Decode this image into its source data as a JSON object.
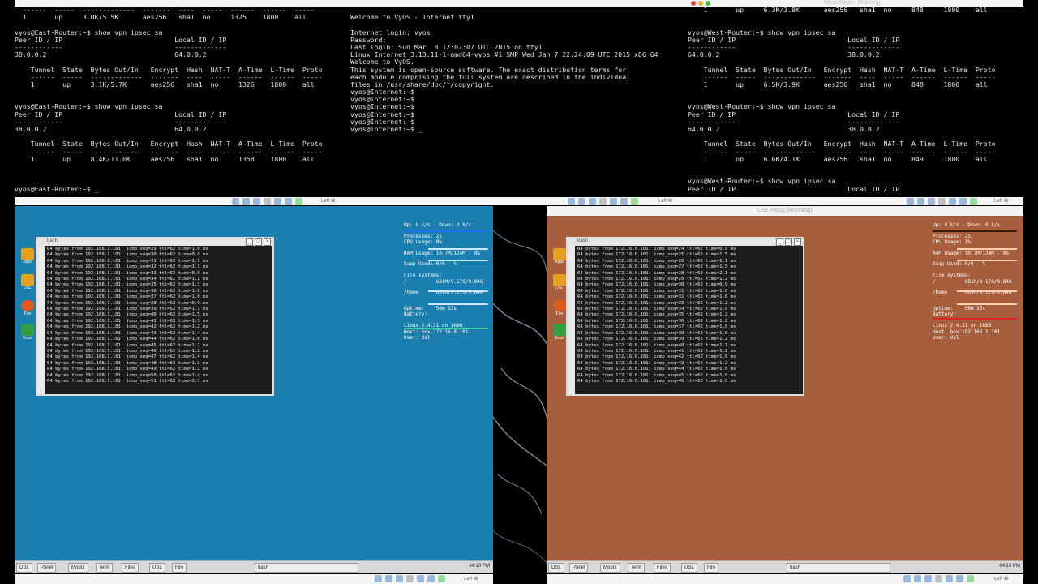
{
  "east_router_terminal": {
    "lines": [
      "  ------  -----  -------------  -------  ----  -----  ------  ------  -----",
      "  1       up     3.0K/5.5K      aes256   sha1  no     1325    1800    all",
      "",
      "vyos@East-Router:~$ show vpn ipsec sa",
      "Peer ID / IP                            Local ID / IP",
      "------------                            -------------",
      "38.0.0.2                                64.0.0.2",
      "",
      "    Tunnel  State  Bytes Out/In   Encrypt  Hash  NAT-T  A-Time  L-Time  Proto",
      "    ------  -----  -------------  -------  ----  -----  ------  ------  -----",
      "    1       up     3.1K/5.7K      aes256   sha1  no     1326    1800    all",
      "",
      "",
      "vyos@East-Router:~$ show vpn ipsec sa",
      "Peer ID / IP                            Local ID / IP",
      "------------                            -------------",
      "38.0.0.2                                64.0.0.2",
      "",
      "    Tunnel  State  Bytes Out/In   Encrypt  Hash  NAT-T  A-Time  L-Time  Proto",
      "    ------  -----  -------------  -------  ----  -----  ------  ------  -----",
      "    1       up     8.4K/11.0K     aes256   sha1  no     1358    1800    all",
      "",
      "",
      "",
      "vyos@East-Router:~$ _"
    ]
  },
  "internet_terminal": {
    "lines": [
      "",
      "Welcome to VyOS - Internet tty1",
      "",
      "Internet login: vyos",
      "Password:",
      "Last login: Sun Mar  8 12:07:07 UTC 2015 on tty1",
      "Linux Internet 3.13.11-1-amd64-vyos #1 SMP Wed Jan 7 22:24:09 UTC 2015 x86_64",
      "Welcome to VyOS.",
      "This system is open-source software. The exact distribution terms for",
      "each module comprising the full system are described in the individual",
      "files in /usr/share/doc/*/copyright.",
      "vyos@Internet:~$",
      "vyos@Internet:~$",
      "vyos@Internet:~$",
      "vyos@Internet:~$",
      "vyos@Internet:~$",
      "vyos@Internet:~$ _"
    ]
  },
  "west_router_terminal": {
    "lines": [
      "    1       up     6.3K/3.8K      aes256   sha1  no     848     1800    all",
      "",
      "",
      "vyos@West-Router:~$ show vpn ipsec sa",
      "Peer ID / IP                            Local ID / IP",
      "------------                            -------------",
      "64.0.0.2                                38.0.0.2",
      "",
      "    Tunnel  State  Bytes Out/In   Encrypt  Hash  NAT-T  A-Time  L-Time  Proto",
      "    ------  -----  -------------  -------  ----  -----  ------  ------  -----",
      "    1       up     6.5K/3.9K      aes256   sha1  no     848     1800    all",
      "",
      "",
      "vyos@West-Router:~$ show vpn ipsec sa",
      "Peer ID / IP                            Local ID / IP",
      "------------                            -------------",
      "64.0.0.2                                38.0.0.2",
      "",
      "    Tunnel  State  Bytes Out/In   Encrypt  Hash  NAT-T  A-Time  L-Time  Proto",
      "    ------  -----  -------------  -------  ----  -----  ------  ------  -----",
      "    1       up     6.6K/4.1K      aes256   sha1  no     849     1800    all",
      "",
      "",
      "vyos@West-Router:~$ show vpn ipsec sa",
      "Peer ID / IP                            Local ID / IP"
    ],
    "window_title": "West-Router [Running]"
  },
  "vm_bars": {
    "right_key_label": "Left ⌘",
    "right_window_title": "DSL-Host2 [Running]"
  },
  "left_vm": {
    "bg_color": "#1a7fae",
    "xterm": {
      "title": "bash",
      "lines": [
        "64 bytes from 192.168.1.101: icmp_seq=29 ttl=62 time=1.0 ms",
        "64 bytes from 192.168.1.101: icmp_seq=30 ttl=62 time=0.9 ms",
        "64 bytes from 192.168.1.101: icmp_seq=31 ttl=62 time=1.1 ms",
        "64 bytes from 192.168.1.101: icmp_seq=32 ttl=62 time=1.1 ms",
        "64 bytes from 192.168.1.101: icmp_seq=33 ttl=62 time=0.9 ms",
        "64 bytes from 192.168.1.101: icmp_seq=34 ttl=62 time=1.2 ms",
        "64 bytes from 192.168.1.101: icmp_seq=35 ttl=62 time=1.3 ms",
        "64 bytes from 192.168.1.101: icmp_seq=36 ttl=62 time=1.0 ms",
        "64 bytes from 192.168.1.101: icmp_seq=37 ttl=62 time=1.0 ms",
        "64 bytes from 192.168.1.101: icmp_seq=38 ttl=62 time=0.9 ms",
        "64 bytes from 192.168.1.101: icmp_seq=39 ttl=62 time=1.1 ms",
        "64 bytes from 192.168.1.101: icmp_seq=40 ttl=62 time=1.5 ms",
        "64 bytes from 192.168.1.101: icmp_seq=41 ttl=62 time=1.1 ms",
        "64 bytes from 192.168.1.101: icmp_seq=42 ttl=62 time=1.2 ms",
        "64 bytes from 192.168.1.101: icmp_seq=43 ttl=62 time=1.4 ms",
        "64 bytes from 192.168.1.101: icmp_seq=44 ttl=62 time=1.0 ms",
        "64 bytes from 192.168.1.101: icmp_seq=45 ttl=62 time=1.2 ms",
        "64 bytes from 192.168.1.101: icmp_seq=46 ttl=62 time=1.2 ms",
        "64 bytes from 192.168.1.101: icmp_seq=47 ttl=62 time=1.4 ms",
        "64 bytes from 192.168.1.101: icmp_seq=48 ttl=62 time=1.3 ms",
        "64 bytes from 192.168.1.101: icmp_seq=49 ttl=62 time=1.2 ms",
        "64 bytes from 192.168.1.101: icmp_seq=50 ttl=62 time=1.4 ms",
        "64 bytes from 192.168.1.101: icmp_seq=51 ttl=62 time=3.7 ms"
      ]
    },
    "conky": {
      "lines": [
        "Up: 0 k/s - Down: 0 k/s",
        "",
        "Processes: 25",
        "CPU Usage: 0%",
        "",
        "RAM Usage: 10.7M/124M - 8%",
        "",
        "Swap Used: 0/0 - %",
        "",
        "File systems:",
        "/          681M/9.17G/9.84G",
        "",
        "/home      681M/9.17G/9.84G",
        "",
        "",
        "Uptime:    56m 12s",
        "Battery:",
        "",
        "Linux 2.4.31 on i686",
        "Host: box 172.16.0.101",
        "User: dsl"
      ]
    },
    "taskbar": {
      "items": [
        "DSL",
        "Panel",
        "Mount",
        "Term",
        "Files",
        "DSL",
        "Fire"
      ],
      "window_button": "bash",
      "clock": "04:10 PM"
    }
  },
  "right_vm": {
    "bg_color": "#a65e3c",
    "xterm": {
      "title": "bash",
      "lines": [
        "64 bytes from 172.16.0.101: icmp_seq=24 ttl=62 time=0.9 ms",
        "64 bytes from 172.16.0.101: icmp_seq=25 ttl=62 time=1.5 ms",
        "64 bytes from 172.16.0.101: icmp_seq=26 ttl=62 time=1.1 ms",
        "64 bytes from 172.16.0.101: icmp_seq=27 ttl=62 time=1.5 ms",
        "64 bytes from 172.16.0.101: icmp_seq=28 ttl=62 time=2.1 ms",
        "64 bytes from 172.16.0.101: icmp_seq=29 ttl=62 time=1.2 ms",
        "64 bytes from 172.16.0.101: icmp_seq=30 ttl=62 time=0.9 ms",
        "64 bytes from 172.16.0.101: icmp_seq=31 ttl=62 time=1.0 ms",
        "64 bytes from 172.16.0.101: icmp_seq=32 ttl=62 time=1.6 ms",
        "64 bytes from 172.16.0.101: icmp_seq=33 ttl=62 time=1.2 ms",
        "64 bytes from 172.16.0.101: icmp_seq=34 ttl=62 time=1.0 ms",
        "64 bytes from 172.16.0.101: icmp_seq=35 ttl=62 time=1.2 ms",
        "64 bytes from 172.16.0.101: icmp_seq=36 ttl=62 time=1.2 ms",
        "64 bytes from 172.16.0.101: icmp_seq=37 ttl=62 time=1.0 ms",
        "64 bytes from 172.16.0.101: icmp_seq=38 ttl=62 time=1.0 ms",
        "64 bytes from 172.16.0.101: icmp_seq=39 ttl=62 time=1.2 ms",
        "64 bytes from 172.16.0.101: icmp_seq=40 ttl=62 time=1.1 ms",
        "64 bytes from 172.16.0.101: icmp_seq=41 ttl=62 time=1.2 ms",
        "64 bytes from 172.16.0.101: icmp_seq=42 ttl=62 time=1.6 ms",
        "64 bytes from 172.16.0.101: icmp_seq=43 ttl=62 time=1.2 ms",
        "64 bytes from 172.16.0.101: icmp_seq=44 ttl=62 time=1.0 ms",
        "64 bytes from 172.16.0.101: icmp_seq=45 ttl=62 time=1.0 ms",
        "64 bytes from 172.16.0.101: icmp_seq=46 ttl=62 time=1.0 ms"
      ]
    },
    "conky": {
      "lines": [
        "Up: 0 k/s - Down: 0 k/s",
        "",
        "Processes: 25",
        "CPU Usage: 1%",
        "",
        "RAM Usage: 10.7M/124M - 8%",
        "",
        "Swap Used: 0/0 - %",
        "",
        "File systems:",
        "/          681M/9.17G/9.84G",
        "",
        "/home      681M/9.17G/9.84G",
        "",
        "",
        "Uptime:    56m 25s",
        "Battery:",
        "",
        "Linux 2.4.31 on i686",
        "Host: box 192.168.1.101",
        "User: dsl"
      ]
    },
    "taskbar": {
      "items": [
        "DSL",
        "Panel",
        "Mount",
        "Term",
        "Files",
        "DSL",
        "Fire"
      ],
      "window_button": "bash",
      "clock": "04:10 PM"
    }
  },
  "desktop_icons": [
    "Apps",
    "DSL",
    "Fire",
    "Emul"
  ],
  "bottom_key_label": "Left ⌘",
  "colors": {
    "terminal_bg": "#000000",
    "terminal_fg": "#e6e6e6",
    "ping_text": "#e8e8e8",
    "conky_left": "#ffffff",
    "conky_right": "#ffffff",
    "bar_blue": "#1e6fff",
    "bar_red": "#e02020"
  }
}
